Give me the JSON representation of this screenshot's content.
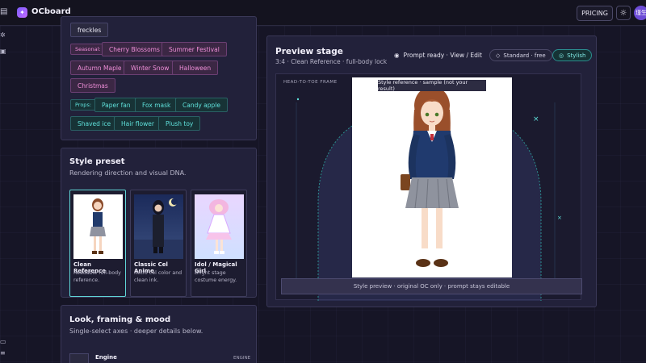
{
  "app": {
    "brand": "OCboard",
    "pricing_label": "PRICING",
    "avatar_text": "瑾生"
  },
  "tags_panel": {
    "top_chip": "freckles",
    "seasonal_label": "Seasonal:",
    "seasonal": [
      "Cherry Blossoms",
      "Summer Festival",
      "Autumn Maple",
      "Winter Snow",
      "Halloween",
      "Christmas"
    ],
    "props_label": "Props:",
    "props": [
      "Paper fan",
      "Fox mask",
      "Candy apple",
      "Shaved ice",
      "Hair flower",
      "Plush toy"
    ]
  },
  "style_preset": {
    "title": "Style preset",
    "subtitle": "Rendering direction and visual DNA.",
    "cards": [
      {
        "name": "Clean Reference",
        "desc": "Readable full-body reference.",
        "selected": true
      },
      {
        "name": "Classic Cel Anime",
        "desc": "Retro cel color and clean ink.",
        "selected": false
      },
      {
        "name": "Idol / Magical Girl",
        "desc": "Bright stage costume energy.",
        "selected": false
      }
    ]
  },
  "look_panel": {
    "title": "Look, framing & mood",
    "subtitle": "Single-select axes · deeper details below.",
    "engine_label": "Engine",
    "engine_tag": "ENGINE"
  },
  "preview": {
    "title": "Preview stage",
    "meta": "3:4 · Clean Reference · full-body lock",
    "status": "Prompt ready · View / Edit",
    "standard_pill": "Standard · free",
    "stylish_pill": "Stylish",
    "frame_label": "HEAD-TO-TOE FRAME",
    "ref_tag": "Style reference · sample (not your result)",
    "bottom_bar": "Style preview · original OC only · prompt stays editable"
  },
  "colors": {
    "accent_pink": "#f08fd9",
    "accent_teal": "#5fe0da",
    "panel": "#22213a"
  }
}
